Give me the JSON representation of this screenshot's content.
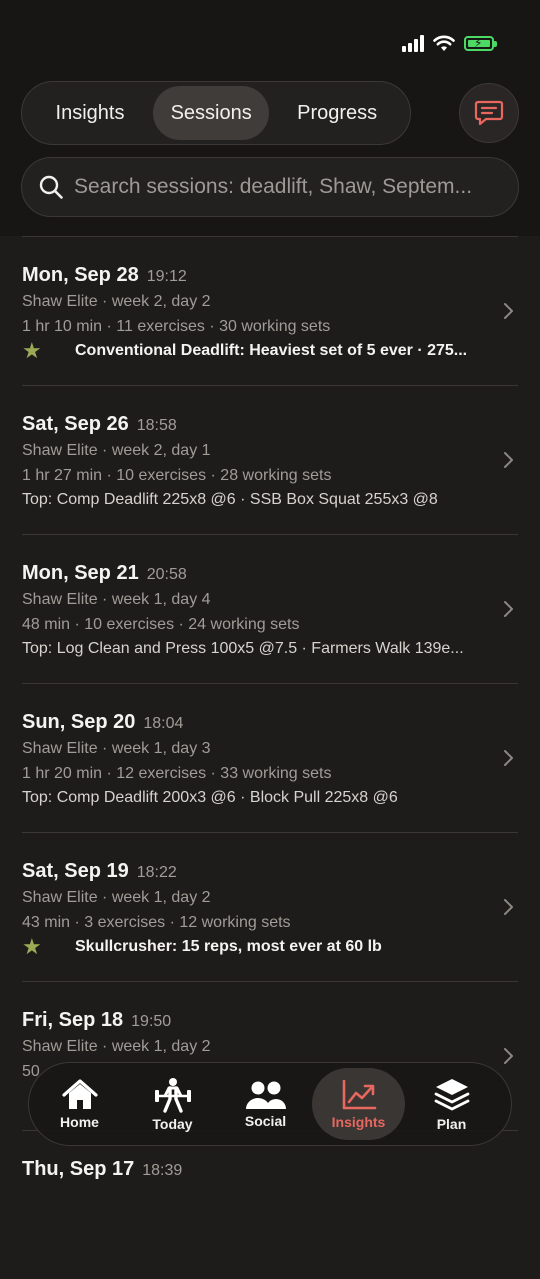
{
  "header": {
    "segments": [
      "Insights",
      "Sessions",
      "Progress"
    ],
    "active_segment": "Sessions"
  },
  "search": {
    "placeholder": "Search sessions: deadlift, Shaw, Septem...",
    "value": ""
  },
  "sessions": [
    {
      "date": "Mon, Sep 28",
      "time": "19:12",
      "plan": "Shaw Elite · week 2, day 2",
      "stats": "1 hr 10 min · 11 exercises · 30 working sets",
      "top": "",
      "pr": "Conventional Deadlift: Heaviest set of 5 ever · 275..."
    },
    {
      "date": "Sat, Sep 26",
      "time": "18:58",
      "plan": "Shaw Elite · week 2, day 1",
      "stats": "1 hr 27 min · 10 exercises · 28 working sets",
      "top": "Top: Comp Deadlift 225x8 @6 · SSB Box Squat 255x3 @8",
      "pr": ""
    },
    {
      "date": "Mon, Sep 21",
      "time": "20:58",
      "plan": "Shaw Elite · week 1, day 4",
      "stats": "48 min · 10 exercises · 24 working sets",
      "top": "Top: Log Clean and Press 100x5 @7.5 · Farmers Walk 139e...",
      "pr": ""
    },
    {
      "date": "Sun, Sep 20",
      "time": "18:04",
      "plan": "Shaw Elite · week 1, day 3",
      "stats": "1 hr 20 min · 12 exercises · 33 working sets",
      "top": "Top: Comp Deadlift 200x3 @6 · Block Pull 225x8 @6",
      "pr": ""
    },
    {
      "date": "Sat, Sep 19",
      "time": "18:22",
      "plan": "Shaw Elite · week 1, day 2",
      "stats": "43 min · 3 exercises · 12 working sets",
      "top": "",
      "pr": "Skullcrusher: 15 reps, most ever at 60 lb"
    },
    {
      "date": "Fri, Sep 18",
      "time": "19:50",
      "plan": "Shaw Elite · week 1, day 2",
      "stats": "50",
      "top": "",
      "pr": ""
    },
    {
      "date": "Thu, Sep 17",
      "time": "18:39",
      "plan": "",
      "stats": "",
      "top": "",
      "pr": ""
    }
  ],
  "tabbar": {
    "tabs": [
      {
        "label": "Home",
        "icon": "house-icon"
      },
      {
        "label": "Today",
        "icon": "weightlifter-icon"
      },
      {
        "label": "Social",
        "icon": "people-icon"
      },
      {
        "label": "Insights",
        "icon": "trend-chart-icon"
      },
      {
        "label": "Plan",
        "icon": "layers-icon"
      }
    ],
    "active": "Insights",
    "active_color": "#e8685f"
  },
  "colors": {
    "accent": "#e8685f",
    "star": "#9bab55",
    "battery": "#4cd964"
  }
}
